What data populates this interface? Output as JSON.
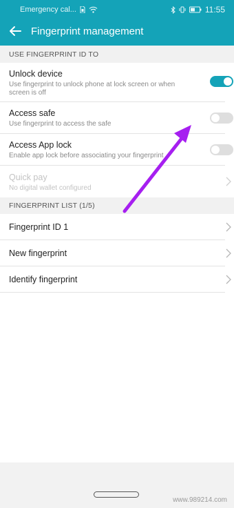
{
  "status": {
    "carrier": "Emergency cal...",
    "time": "11:55"
  },
  "header": {
    "title": "Fingerprint management"
  },
  "sections": {
    "use_title": "USE FINGERPRINT ID TO",
    "list_title": "FINGERPRINT LIST (1/5)"
  },
  "settings": [
    {
      "title": "Unlock device",
      "subtitle": "Use fingerprint to unlock phone at lock screen or when screen is off",
      "toggle": "on"
    },
    {
      "title": "Access safe",
      "subtitle": "Use fingerprint to access the safe",
      "toggle": "off"
    },
    {
      "title": "Access App lock",
      "subtitle": "Enable app lock before associating your fingerprint",
      "toggle": "off"
    },
    {
      "title": "Quick pay",
      "subtitle": "No digital wallet configured",
      "disabled": true
    }
  ],
  "fingerprints": [
    {
      "title": "Fingerprint ID 1"
    },
    {
      "title": "New fingerprint"
    },
    {
      "title": "Identify fingerprint"
    }
  ],
  "watermark": "www.989214.com",
  "colors": {
    "accent": "#14a3b8",
    "annotation_arrow": "#a61ff0"
  }
}
